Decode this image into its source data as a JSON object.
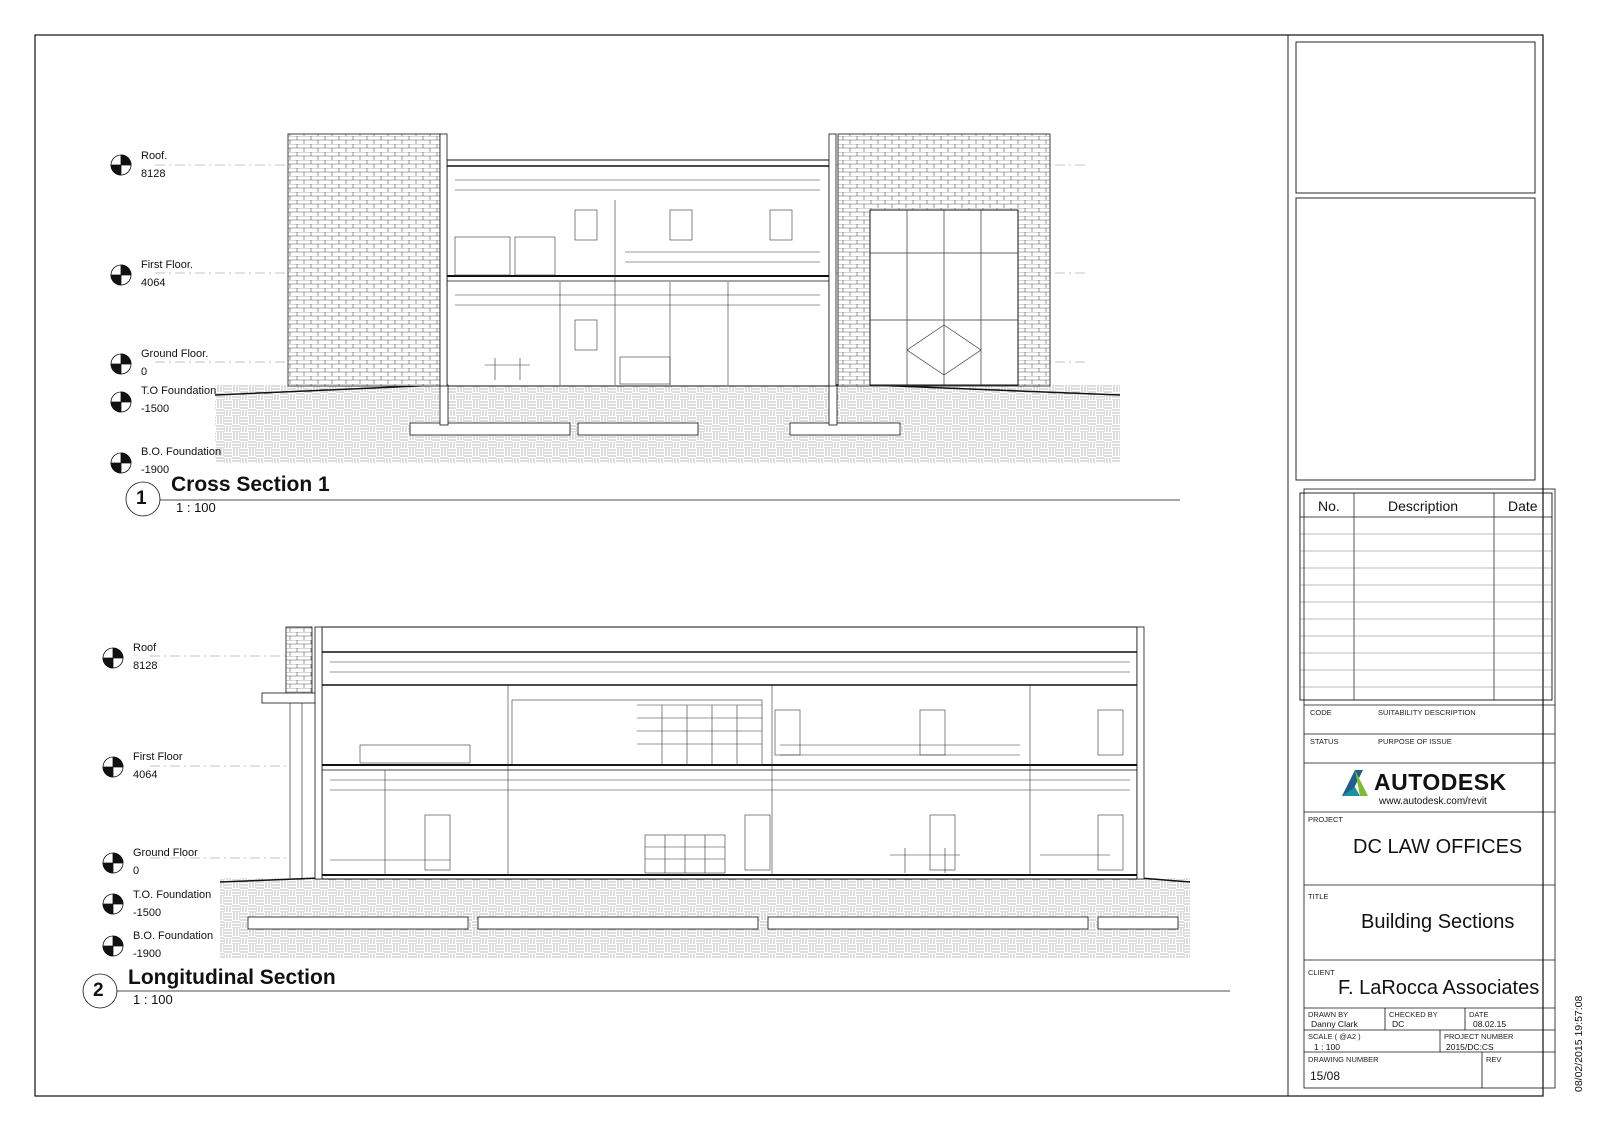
{
  "views": [
    {
      "number": "1",
      "title": "Cross Section 1",
      "scale": "1 : 100",
      "levels": [
        {
          "name": "Roof.",
          "elevation": "8128"
        },
        {
          "name": "First Floor.",
          "elevation": "4064"
        },
        {
          "name": "Ground Floor.",
          "elevation": "0"
        },
        {
          "name": "T.O Foundation",
          "elevation": "-1500"
        },
        {
          "name": "B.O. Foundation",
          "elevation": "-1900"
        }
      ]
    },
    {
      "number": "2",
      "title": "Longitudinal Section",
      "scale": "1 : 100",
      "levels": [
        {
          "name": "Roof",
          "elevation": "8128"
        },
        {
          "name": "First Floor",
          "elevation": "4064"
        },
        {
          "name": "Ground Floor",
          "elevation": "0"
        },
        {
          "name": "T.O. Foundation",
          "elevation": "-1500"
        },
        {
          "name": "B.O. Foundation",
          "elevation": "-1900"
        }
      ]
    }
  ],
  "revision_table": {
    "headers": [
      "No.",
      "Description",
      "Date"
    ],
    "rows": []
  },
  "title_block": {
    "code_label": "CODE",
    "suitability_label": "SUITABILITY DESCRIPTION",
    "status_label": "STATUS",
    "purpose_label": "PURPOSE OF ISSUE",
    "logo_word": "AUTODESK",
    "logo_url": "www.autodesk.com/revit",
    "project_label": "PROJECT",
    "project": "DC LAW OFFICES",
    "title_label": "TITLE",
    "title": "Building Sections",
    "client_label": "CLIENT",
    "client": "F. LaRocca Associates",
    "drawn_by_label": "DRAWN BY",
    "drawn_by": "Danny Clark",
    "checked_by_label": "CHECKED BY",
    "checked_by": "DC",
    "date_label": "DATE",
    "date": "08.02.15",
    "scale_label": "SCALE ( @A2 )",
    "scale": "1 : 100",
    "project_number_label": "PROJECT NUMBER",
    "project_number": "2015/DC:CS",
    "drawing_number_label": "DRAWING NUMBER",
    "drawing_number": "15/08",
    "rev_label": "REV"
  },
  "timestamp": "08/02/2015 19:57:08",
  "colors": {
    "line": "#111111",
    "logo_teal": "#1f8fa0",
    "logo_green": "#7dbb3a",
    "logo_dark": "#1f5f8a"
  }
}
